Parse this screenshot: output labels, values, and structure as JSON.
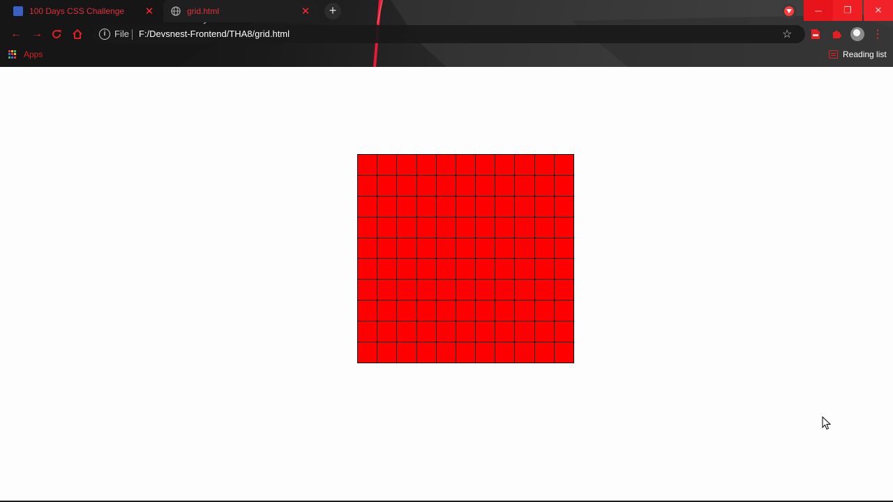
{
  "browser": {
    "tabs": [
      {
        "title": "100 Days CSS Challenge",
        "favicon": "codepen-blue-square-icon",
        "active": false
      },
      {
        "title": "grid.html",
        "favicon": "globe-icon",
        "active": true
      }
    ],
    "address": {
      "scheme": "File",
      "url": "F:/Devsnest-Frontend/THA8/grid.html"
    },
    "bookmarks": {
      "apps_label": "Apps",
      "reading_list_label": "Reading list"
    }
  },
  "page": {
    "grid": {
      "columns": 11,
      "rows": 10,
      "cell_color": "#ff0000",
      "border_color": "#000000"
    }
  },
  "colors": {
    "accent": "#ff2a2a",
    "page_background": "#fdfdfd"
  }
}
